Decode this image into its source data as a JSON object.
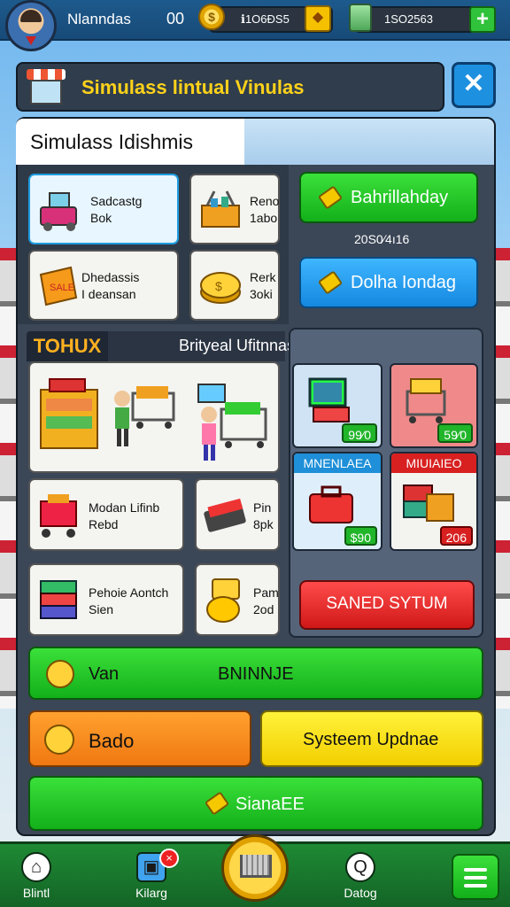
{
  "topbar": {
    "player_name": "Nlanndas",
    "level": "00",
    "coins": "ℹ1O6ÐS5",
    "cash": "1SO2563"
  },
  "title": {
    "text": "Simulass lintual Vinulas"
  },
  "section": {
    "title": "Simulass Idishmis"
  },
  "catalog": {
    "cards": [
      {
        "line1": "Sadcastg",
        "line2": "Bok"
      },
      {
        "line1": "Reno",
        "line2": "1abo"
      },
      {
        "line1": "Dhedassis",
        "line2": "I deansan"
      },
      {
        "line1": "Rerk",
        "line2": "3oki"
      }
    ]
  },
  "actions": {
    "green_button": "Bahrillahday",
    "timestamp": "20S0∕4ı16",
    "blue_button": "Dolha Iondag"
  },
  "tools": {
    "label": "TOHUX",
    "subtitle": "Brityeal Ufitnnas",
    "cards": [
      {
        "line1": "Modan Lifinb",
        "line2": "Rebd"
      },
      {
        "line1": "Pin",
        "line2": "8pk"
      },
      {
        "line1": "Pehoie Aontch",
        "line2": "Sien"
      },
      {
        "line1": "Pam",
        "line2": "2od"
      }
    ]
  },
  "shop": {
    "products": [
      {
        "header": "",
        "price": "99⁄0"
      },
      {
        "header": "",
        "price": "59⁄0"
      },
      {
        "header": "MNENLAEA",
        "price": "$90"
      },
      {
        "header": "MIUIAIEO",
        "price": "206"
      }
    ],
    "red_button": "SANED SYTUM"
  },
  "bottom_buttons": {
    "row1": {
      "left": "Van",
      "center": "BNINNJE"
    },
    "row2": {
      "left": "Bado",
      "right": "Systeem Updnae"
    },
    "row3": "SianaEE"
  },
  "nav": {
    "items": [
      {
        "label": "Blintl"
      },
      {
        "label": "Kilarg",
        "badge": "×"
      },
      {
        "label": "Datog"
      }
    ]
  },
  "colors": {
    "accent_green": "#13b01a",
    "accent_blue": "#1488e0",
    "accent_yellow": "#ffd21a",
    "accent_orange": "#f58a1a",
    "accent_red": "#d01818"
  }
}
